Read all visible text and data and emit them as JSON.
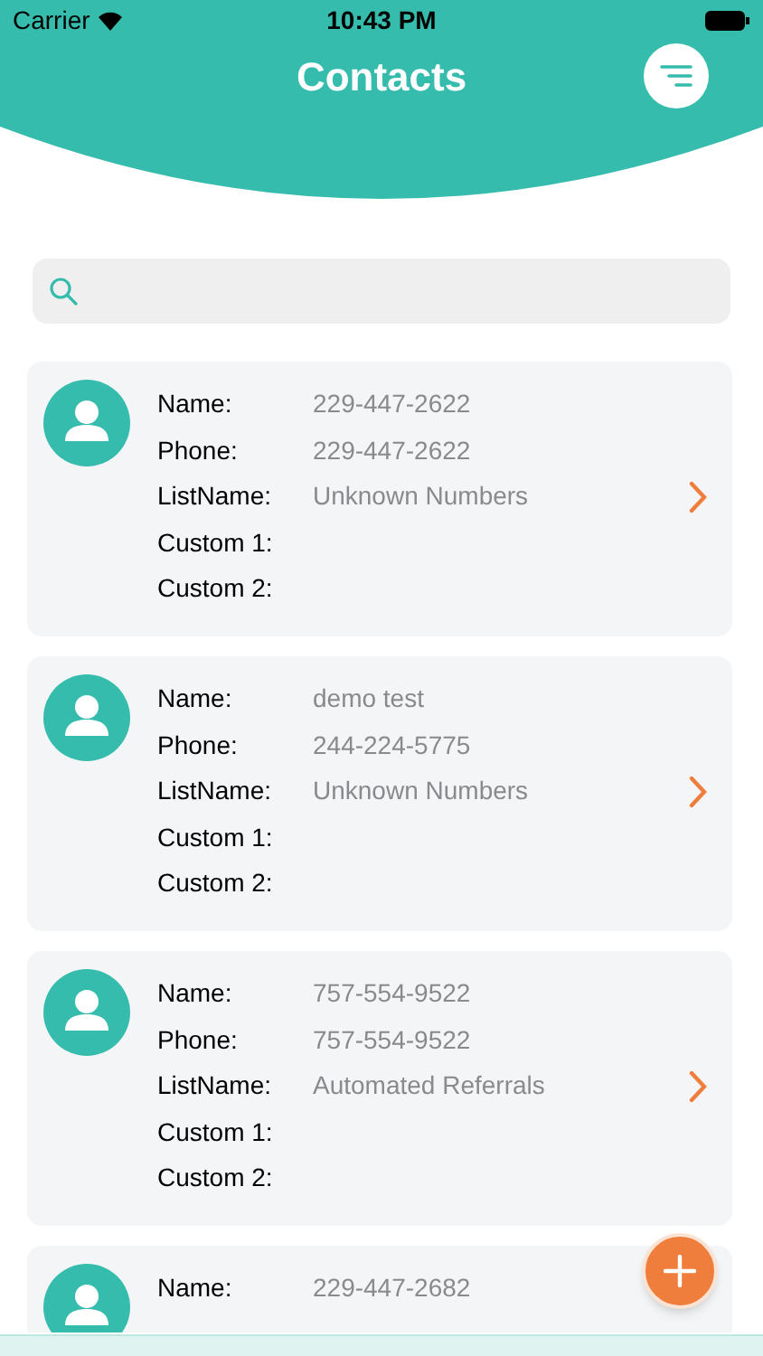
{
  "status_bar": {
    "carrier": "Carrier",
    "time": "10:43 PM"
  },
  "header": {
    "title": "Contacts"
  },
  "contacts": [
    {
      "fields": [
        {
          "label": "Name:",
          "value": "229-447-2622"
        },
        {
          "label": "Phone:",
          "value": "229-447-2622"
        },
        {
          "label": "ListName:",
          "value": "Unknown Numbers"
        },
        {
          "label": "Custom 1:"
        },
        {
          "label": "Custom 2:"
        }
      ]
    },
    {
      "fields": [
        {
          "label": "Name:",
          "value": "demo test"
        },
        {
          "label": "Phone:",
          "value": "244-224-5775"
        },
        {
          "label": "ListName:",
          "value": "Unknown Numbers"
        },
        {
          "label": "Custom 1:"
        },
        {
          "label": "Custom 2:"
        }
      ]
    },
    {
      "fields": [
        {
          "label": "Name:",
          "value": "757-554-9522"
        },
        {
          "label": "Phone:",
          "value": "757-554-9522"
        },
        {
          "label": "ListName:",
          "value": "Automated Referrals"
        },
        {
          "label": "Custom 1:"
        },
        {
          "label": "Custom 2:"
        }
      ]
    },
    {
      "fields": [
        {
          "label": "Name:",
          "value": "229-447-2682"
        }
      ]
    }
  ]
}
